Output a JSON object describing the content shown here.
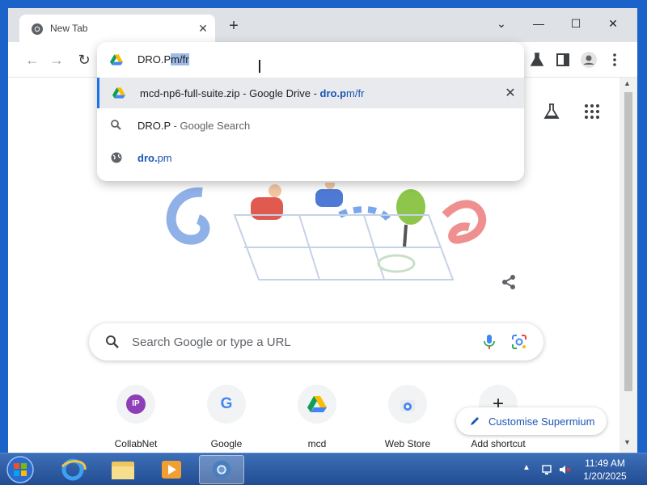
{
  "tab": {
    "title": "New Tab",
    "close": "✕"
  },
  "new_tab": "+",
  "window_controls": {
    "chevron": "⌄",
    "minimize": "—",
    "maximize": "☐",
    "close": "✕"
  },
  "omnibox": {
    "typed": "DRO.P",
    "autocomplete": "m/fr",
    "suggestions": [
      {
        "main": "mcd-np6-full-suite.zip - Google Drive - ",
        "match": "dro.p",
        "rest": "m/fr",
        "icon": "drive-icon",
        "remove": "✕"
      },
      {
        "main": "DRO.P",
        "suffix": " - Google Search",
        "icon": "search-icon"
      },
      {
        "match": "dro.",
        "rest": "pm",
        "icon": "globe-icon"
      }
    ]
  },
  "search": {
    "placeholder": "Search Google or type a URL"
  },
  "shortcuts": [
    {
      "label": "CollabNet",
      "icon": "IP"
    },
    {
      "label": "Google",
      "icon": "G"
    },
    {
      "label": "mcd",
      "icon": "drive"
    },
    {
      "label": "Web Store",
      "icon": "webstore"
    },
    {
      "label": "Add shortcut",
      "icon": "+"
    }
  ],
  "customise": {
    "label": "Customise Supermium"
  },
  "taskbar": {
    "time": "11:49 AM",
    "date": "1/20/2025"
  },
  "colors": {
    "accent": "#1a73e8",
    "taskbar": "#224c91",
    "frame": "#1c63c9"
  }
}
